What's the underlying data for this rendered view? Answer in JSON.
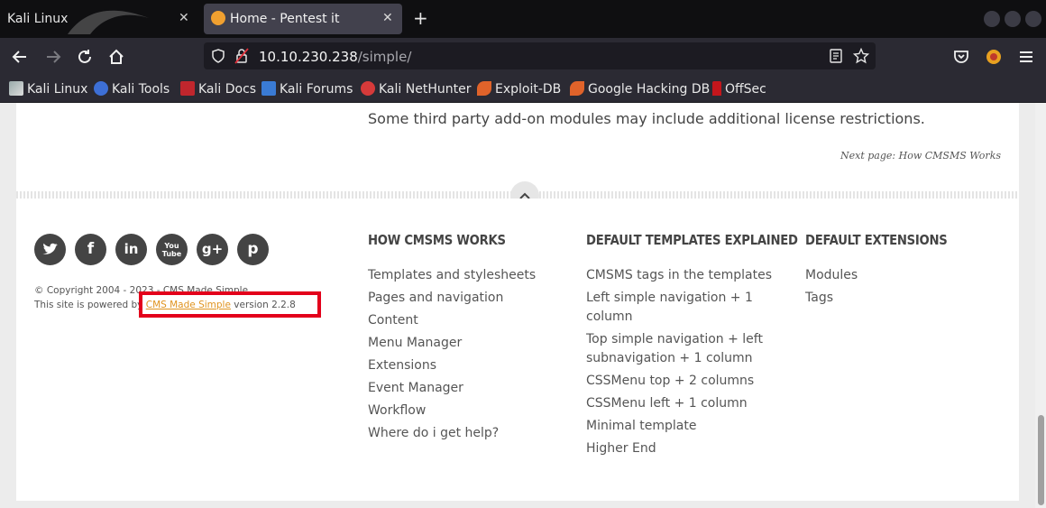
{
  "browser": {
    "tabs": [
      {
        "label": "Kali Linux",
        "active": false
      },
      {
        "label": "Home - Pentest it",
        "active": true
      }
    ],
    "url": {
      "host": "10.10.230.238",
      "path": "/simple/"
    },
    "bookmarks": [
      {
        "label": "Kali Linux",
        "icon": "kali-dragon-icon"
      },
      {
        "label": "Kali Tools",
        "icon": "kali-tools-icon"
      },
      {
        "label": "Kali Docs",
        "icon": "kali-docs-icon"
      },
      {
        "label": "Kali Forums",
        "icon": "kali-forums-icon"
      },
      {
        "label": "Kali NetHunter",
        "icon": "nethunter-icon"
      },
      {
        "label": "Exploit-DB",
        "icon": "exploit-db-icon"
      },
      {
        "label": "Google Hacking DB",
        "icon": "ghdb-icon"
      },
      {
        "label": "OffSec",
        "icon": "offsec-icon"
      }
    ]
  },
  "page": {
    "license_text": "Some third party add-on modules may include additional license restrictions.",
    "next_page": "Next page: How CMSMS Works",
    "social": [
      {
        "name": "twitter",
        "glyph": "t"
      },
      {
        "name": "facebook",
        "glyph": "f"
      },
      {
        "name": "linkedin",
        "glyph": "in"
      },
      {
        "name": "youtube",
        "glyph": "You Tube"
      },
      {
        "name": "google-plus",
        "glyph": "g+"
      },
      {
        "name": "pinterest",
        "glyph": "p"
      }
    ],
    "copyright": "© Copyright 2004 - 2023 - CMS Made Simple",
    "powered_prefix": "This site is powered by ",
    "powered_link": "CMS Made Simple",
    "powered_suffix": " version 2.2.8",
    "columns": [
      {
        "heading": "HOW CMSMS WORKS",
        "items": [
          "Templates and stylesheets",
          "Pages and navigation",
          "Content",
          "Menu Manager",
          "Extensions",
          "Event Manager",
          "Workflow",
          "Where do i get help?"
        ]
      },
      {
        "heading": "DEFAULT TEMPLATES EXPLAINED",
        "items": [
          "CMSMS tags in the templates",
          "Left simple navigation + 1 column",
          "Top simple navigation + left subnavigation + 1 column",
          "CSSMenu top + 2 columns",
          "CSSMenu left + 1 column",
          "Minimal template",
          "Higher End"
        ]
      },
      {
        "heading": "DEFAULT EXTENSIONS",
        "items": [
          "Modules",
          "Tags"
        ]
      }
    ]
  }
}
